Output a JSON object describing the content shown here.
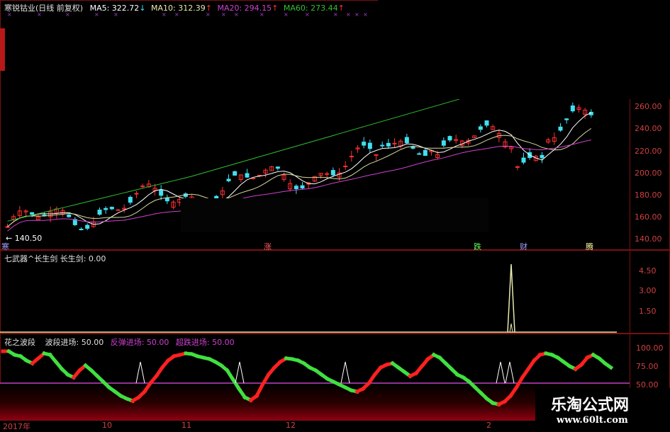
{
  "header": {
    "stock_name": "寒锐钴业(日线 前复权)",
    "ma5_label": "MA5: 322.72",
    "ma5_arrow": "↓",
    "ma10_label": "MA10: 312.39",
    "ma10_arrow": "↑",
    "ma20_label": "MA20: 294.15",
    "ma20_arrow": "↑",
    "ma60_label": "MA60: 273.44",
    "ma60_arrow": "↑"
  },
  "colors": {
    "background": "#000000",
    "up_candle": "#ff3030",
    "down_candle": "#40e0f0",
    "ma5": "#ffffff",
    "ma10": "#d8d8a0",
    "ma20": "#d040d0",
    "ma60": "#30c030",
    "axis": "#d04040",
    "osc_red": "#ff2020",
    "osc_green": "#40e040"
  },
  "price_panel": {
    "y_ticks": [
      "260.00",
      "240.00",
      "220.00",
      "200.00",
      "180.00",
      "160.00",
      "140.00"
    ],
    "low_marker": "← 140.50",
    "event_labels": [
      {
        "text": "涨",
        "color": "#ff6060"
      },
      {
        "text": "跌",
        "color": "#60ff60"
      },
      {
        "text": "财",
        "color": "#a0a0ff"
      },
      {
        "text": "腾",
        "color": "#ffffa0"
      }
    ],
    "first_label": "寒"
  },
  "panel2": {
    "title": "七武器^长生剑 长生剑: 0.00",
    "y_ticks": [
      "4.50",
      "3.00",
      "1.50"
    ]
  },
  "panel3": {
    "title": "花之波段",
    "item1": "波段进场: 50.00",
    "item2": "反弹进场: 50.00",
    "item3": "超跌进场: 50.00",
    "y_ticks": [
      "100.00",
      "75.00",
      "50.00"
    ]
  },
  "x_axis": {
    "labels": [
      "2017年",
      "10",
      "11",
      "12",
      "2"
    ]
  },
  "watermark": {
    "line1": "乐淘公式网",
    "line2": "www.60lt.com"
  },
  "chart_data": [
    {
      "type": "candlestick",
      "title": "寒锐钴业(日线 前复权)",
      "ylim": [
        135,
        270
      ],
      "series": [
        {
          "name": "MA5",
          "values": [
            322.72
          ]
        },
        {
          "name": "MA10",
          "values": [
            312.39
          ]
        },
        {
          "name": "MA20",
          "values": [
            294.15
          ]
        },
        {
          "name": "MA60",
          "values": [
            273.44
          ]
        }
      ],
      "annotations": [
        "140.50"
      ]
    },
    {
      "type": "line",
      "title": "七武器^长生剑 长生剑: 0.00",
      "ylim": [
        0,
        5.5
      ]
    },
    {
      "type": "line",
      "title": "花之波段",
      "ylim": [
        20,
        105
      ],
      "values": [
        95,
        95,
        90,
        88,
        82,
        78,
        85,
        92,
        90,
        80,
        70,
        62,
        58,
        68,
        75,
        68,
        60,
        52,
        44,
        38,
        32,
        28,
        25,
        30,
        38,
        50,
        60,
        72,
        82,
        88,
        90,
        92,
        91,
        88,
        86,
        84,
        80,
        75,
        68,
        55,
        42,
        30,
        26,
        32,
        48,
        62,
        72,
        80,
        85,
        84,
        82,
        78,
        72,
        68,
        62,
        56,
        52,
        48,
        44,
        40,
        38,
        42,
        50,
        62,
        72,
        76,
        78,
        72,
        66,
        60,
        64,
        74,
        84,
        90,
        86,
        78,
        70,
        62,
        58,
        52,
        44,
        36,
        28,
        22,
        20,
        24,
        32,
        44,
        58,
        70,
        82,
        90,
        92,
        90,
        86,
        80,
        74,
        70,
        76,
        86,
        90,
        85,
        78,
        72
      ]
    }
  ]
}
